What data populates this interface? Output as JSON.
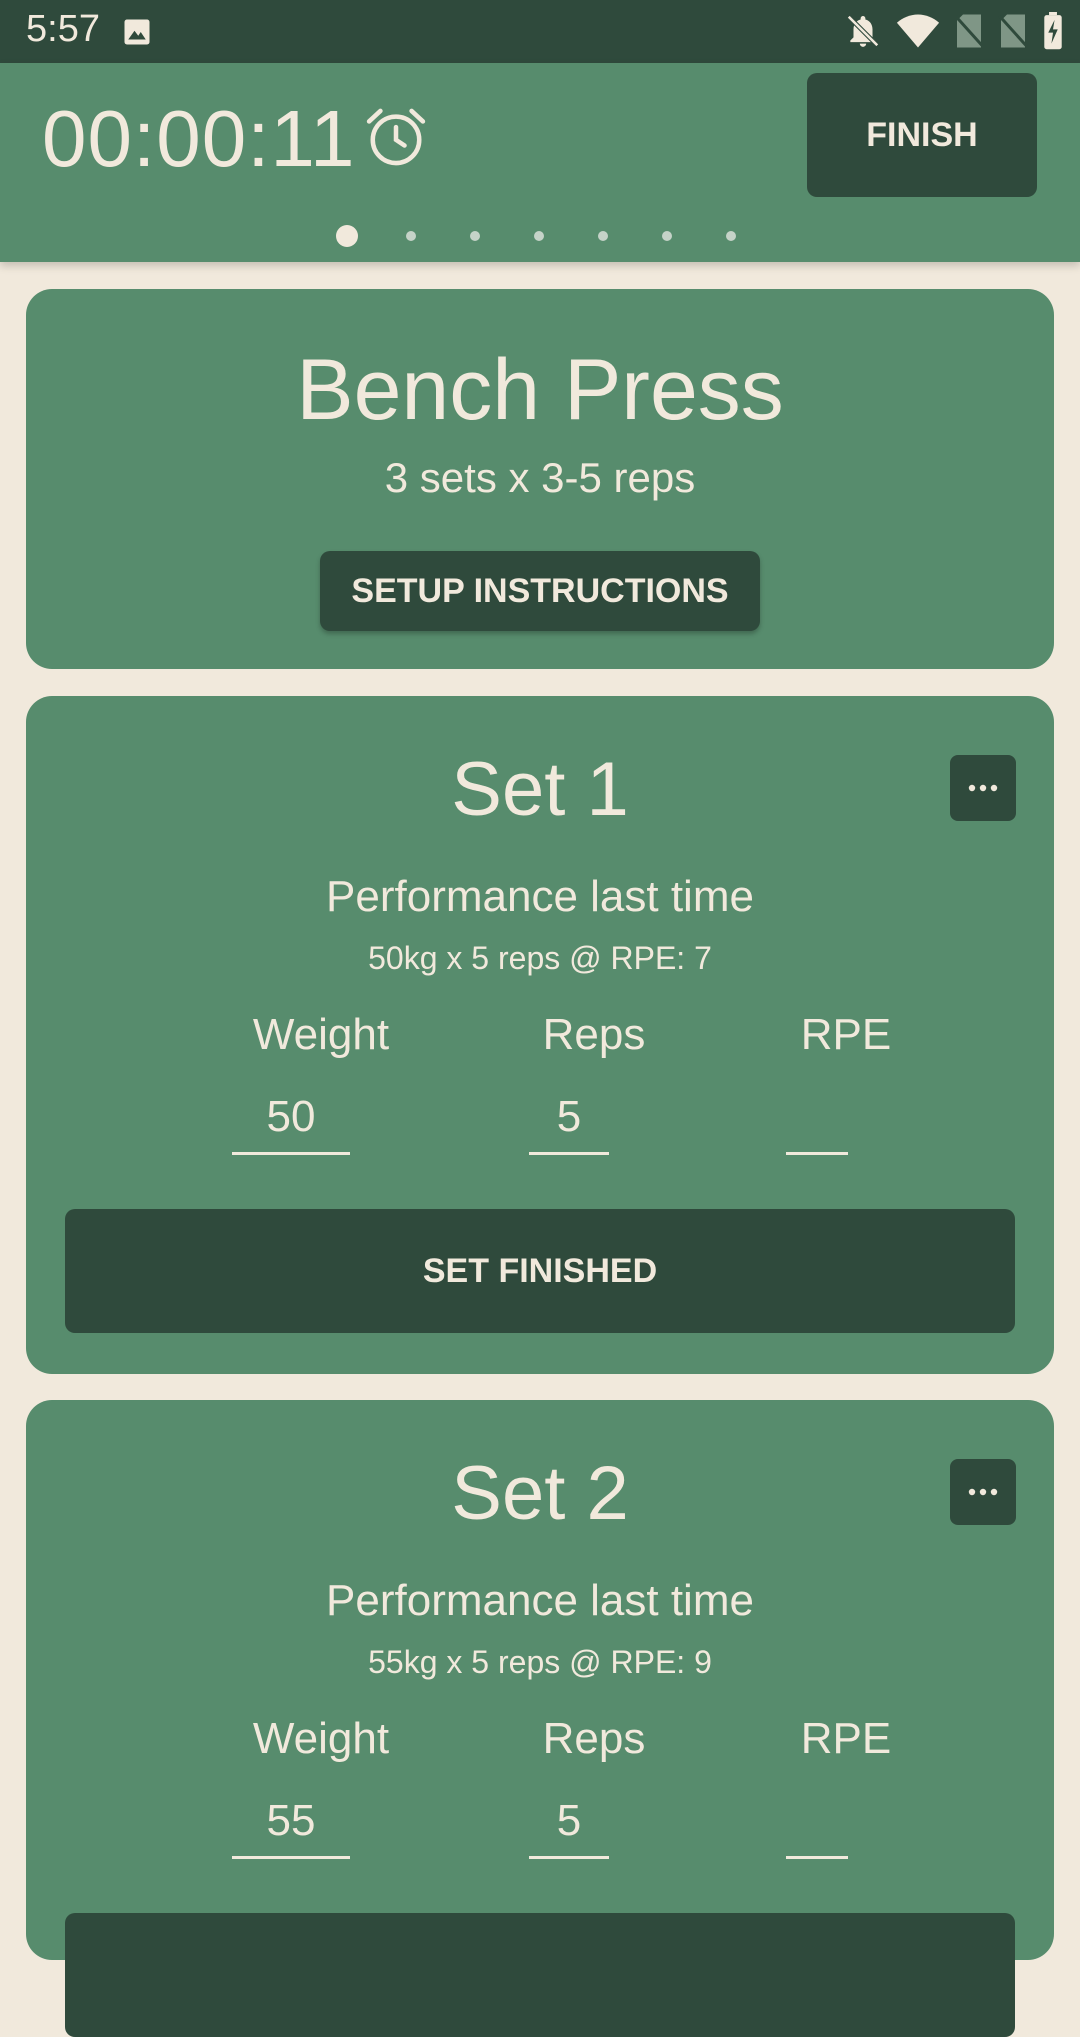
{
  "status_bar": {
    "time": "5:57",
    "icons": [
      "image-icon",
      "notifications-off-icon",
      "wifi-icon",
      "no-sim-icon",
      "no-sim-icon",
      "battery-charging-icon"
    ]
  },
  "header": {
    "timer": "00:00:11",
    "timer_icon": "alarm-icon",
    "finish_label": "FINISH",
    "page_count": 7,
    "active_page": 1
  },
  "exercise": {
    "name": "Bench Press",
    "scheme": "3 sets x 3-5 reps",
    "setup_label": "SETUP INSTRUCTIONS"
  },
  "sets": [
    {
      "title": "Set 1",
      "perf_label": "Performance last time",
      "perf_value": "50kg x 5 reps @ RPE: 7",
      "weight_label": "Weight",
      "reps_label": "Reps",
      "rpe_label": "RPE",
      "weight": "50",
      "reps": "5",
      "rpe": "",
      "finish_label": "SET FINISHED"
    },
    {
      "title": "Set 2",
      "perf_label": "Performance last time",
      "perf_value": "55kg x 5 reps @ RPE: 9",
      "weight_label": "Weight",
      "reps_label": "Reps",
      "rpe_label": "RPE",
      "weight": "55",
      "reps": "5",
      "rpe": ""
    }
  ],
  "colors": {
    "background": "#f1e9dc",
    "primary": "#578c6d",
    "primary_dark": "#2f4a3c",
    "on_primary": "#f1e9dc"
  }
}
